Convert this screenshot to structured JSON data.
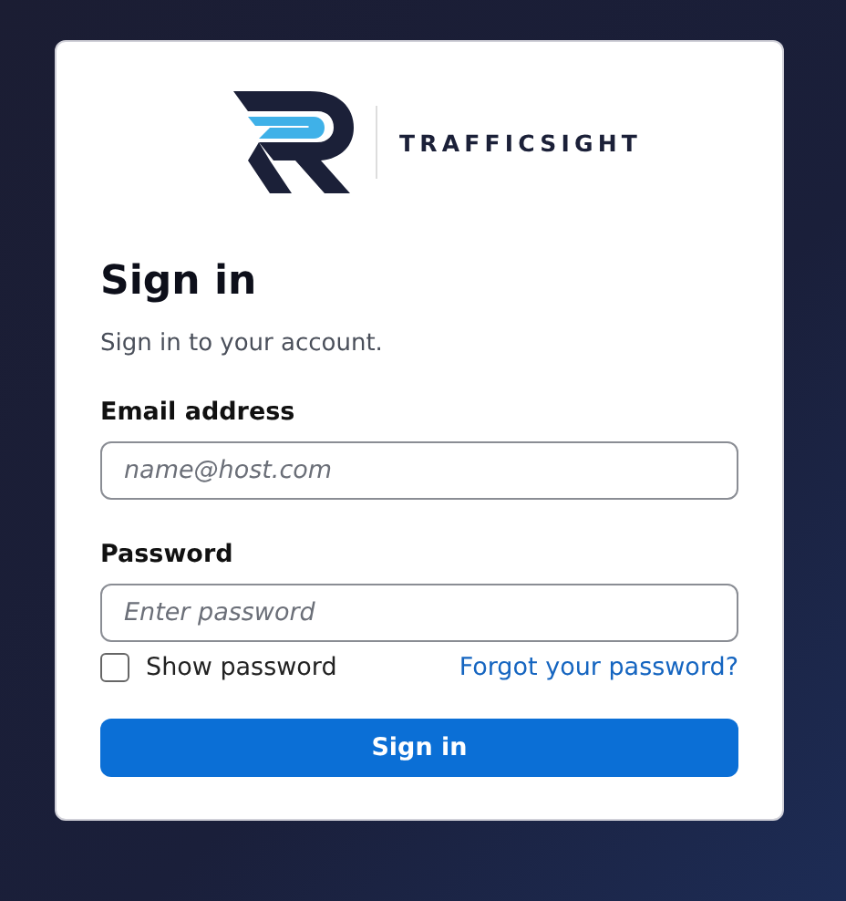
{
  "logo": {
    "wordmark": "TRAFFICSIGHT"
  },
  "heading": "Sign in",
  "subtitle": "Sign in to your account.",
  "fields": [
    {
      "label": "Email address",
      "placeholder": "name@host.com"
    },
    {
      "label": "Password",
      "placeholder": "Enter password"
    }
  ],
  "show_password": {
    "label": "Show password",
    "checked": false
  },
  "forgot_link": "Forgot your password?",
  "submit_button": "Sign in"
}
